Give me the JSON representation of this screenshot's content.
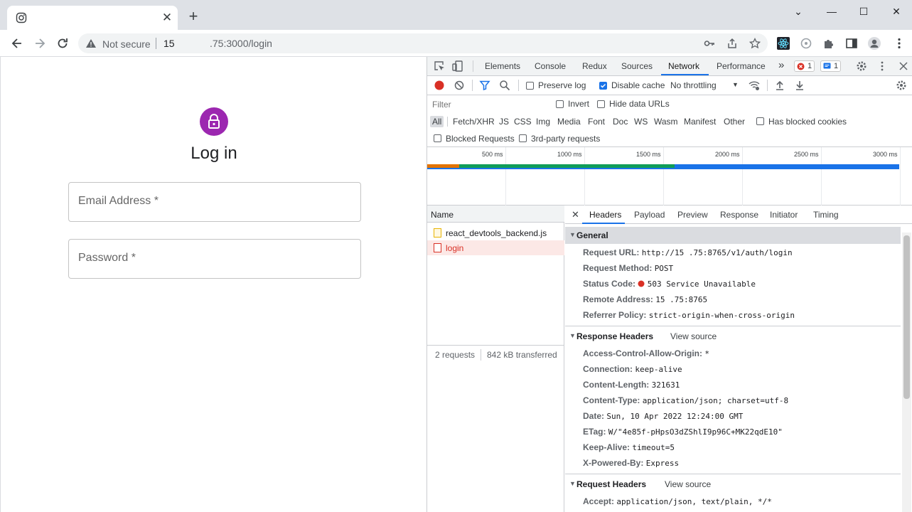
{
  "browser": {
    "tab_title": "",
    "new_tab_label": "+",
    "close_label": "✕",
    "window_controls": {
      "minimize": "—",
      "maximize": "☐",
      "close": "✕",
      "tabs_menu": "⌄"
    },
    "security_label": "Not secure",
    "url_host_prefix": "15",
    "url_rest": ".75:3000/login"
  },
  "page": {
    "title": "Log in",
    "email_label": "Email Address *",
    "password_label": "Password *",
    "avatar_color": "#9c27b0"
  },
  "devtools": {
    "tabs": [
      "Elements",
      "Console",
      "Redux",
      "Sources",
      "Network",
      "Performance"
    ],
    "more_tabs": "»",
    "active_tab": "Network",
    "error_count": "1",
    "message_count": "1",
    "toolbar": {
      "preserve_log": "Preserve log",
      "disable_cache": "Disable cache",
      "throttling": "No throttling",
      "throttling_caret": "▼"
    },
    "filter": {
      "placeholder": "Filter",
      "invert": "Invert",
      "hide_data_urls": "Hide data URLs",
      "types": [
        "All",
        "Fetch/XHR",
        "JS",
        "CSS",
        "Img",
        "Media",
        "Font",
        "Doc",
        "WS",
        "Wasm",
        "Manifest",
        "Other"
      ],
      "has_blocked_cookies": "Has blocked cookies",
      "blocked_requests": "Blocked Requests",
      "third_party": "3rd-party requests"
    },
    "timeline": {
      "ticks": [
        "500 ms",
        "1000 ms",
        "1500 ms",
        "2000 ms",
        "2500 ms",
        "3000 ms"
      ]
    },
    "requests": {
      "header": "Name",
      "items": [
        {
          "name": "react_devtools_backend.js",
          "status": "ok"
        },
        {
          "name": "login",
          "status": "error"
        }
      ],
      "footer_count": "2 requests",
      "footer_transferred": "842 kB transferred"
    },
    "details": {
      "close": "✕",
      "tabs": [
        "Headers",
        "Payload",
        "Preview",
        "Response",
        "Initiator",
        "Timing"
      ],
      "general": {
        "title": "General",
        "rows": [
          {
            "k": "Request URL:",
            "v": "http://15        .75:8765/v1/auth/login"
          },
          {
            "k": "Request Method:",
            "v": "POST"
          },
          {
            "k": "Status Code:",
            "v": "503 Service Unavailable"
          },
          {
            "k": "Remote Address:",
            "v": "15        .75:8765"
          },
          {
            "k": "Referrer Policy:",
            "v": "strict-origin-when-cross-origin"
          }
        ]
      },
      "response_headers": {
        "title": "Response Headers",
        "view_source": "View source",
        "rows": [
          {
            "k": "Access-Control-Allow-Origin:",
            "v": "*"
          },
          {
            "k": "Connection:",
            "v": "keep-alive"
          },
          {
            "k": "Content-Length:",
            "v": "321631"
          },
          {
            "k": "Content-Type:",
            "v": "application/json; charset=utf-8"
          },
          {
            "k": "Date:",
            "v": "Sun, 10 Apr 2022 12:24:00 GMT"
          },
          {
            "k": "ETag:",
            "v": "W/\"4e85f-pHpsO3dZShlI9p96C+MK22qdE10\""
          },
          {
            "k": "Keep-Alive:",
            "v": "timeout=5"
          },
          {
            "k": "X-Powered-By:",
            "v": "Express"
          }
        ]
      },
      "request_headers": {
        "title": "Request Headers",
        "view_source": "View source",
        "rows": [
          {
            "k": "Accept:",
            "v": "application/json, text/plain, */*"
          }
        ]
      }
    }
  }
}
